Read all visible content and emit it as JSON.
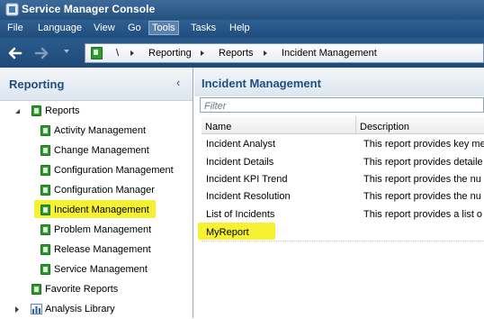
{
  "window": {
    "title": "Service Manager Console"
  },
  "menu": {
    "items": [
      "File",
      "Language",
      "View",
      "Go",
      "Tools",
      "Tasks",
      "Help"
    ],
    "active": "Tools"
  },
  "address": {
    "root": "\\",
    "crumbs": [
      "Reporting",
      "Reports",
      "Incident Management"
    ]
  },
  "left_pane": {
    "title": "Reporting",
    "root_label": "Reports",
    "items": [
      "Activity Management",
      "Change Management",
      "Configuration Management",
      "Configuration Manager",
      "Incident Management",
      "Problem Management",
      "Release Management",
      "Service Management"
    ],
    "selected": "Incident Management",
    "favorite": "Favorite Reports",
    "library": "Analysis Library"
  },
  "right_pane": {
    "title": "Incident Management",
    "filter_placeholder": "Filter",
    "columns": [
      "Name",
      "Description"
    ],
    "rows": [
      {
        "name": "Incident Analyst",
        "description": "This report provides key me"
      },
      {
        "name": "Incident Details",
        "description": "This report provides detaile"
      },
      {
        "name": "Incident KPI Trend",
        "description": "This report provides the nu"
      },
      {
        "name": "Incident Resolution",
        "description": "This report provides the nu"
      },
      {
        "name": "List of Incidents",
        "description": "This report provides a list o"
      },
      {
        "name": "MyReport",
        "description": ""
      }
    ],
    "selected_row": "MyReport"
  },
  "colors": {
    "highlight": "#f6f233",
    "title_bar": "#2a5b8c",
    "pane_title": "#1f4f80"
  }
}
